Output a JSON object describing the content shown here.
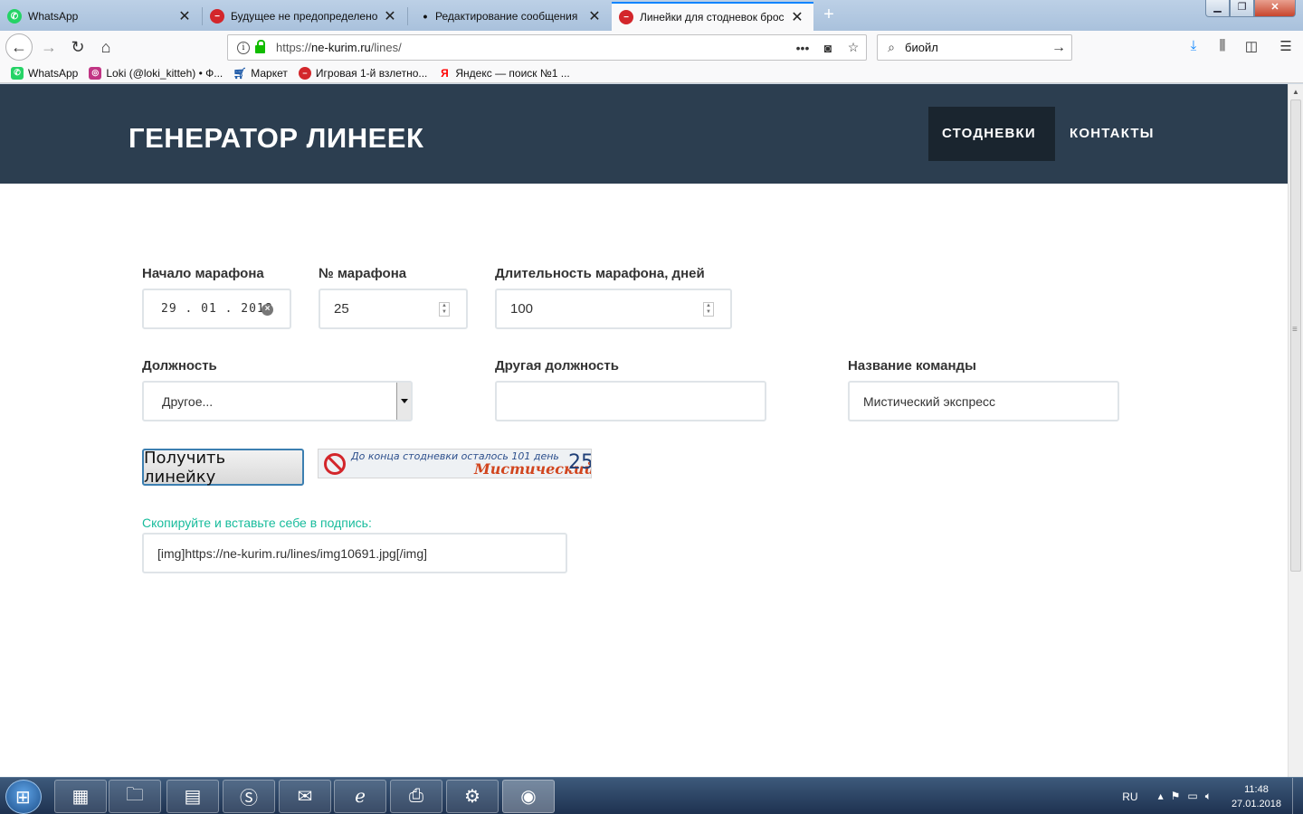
{
  "tabs": [
    {
      "title": "WhatsApp",
      "icon": "whatsapp-icon",
      "color": "#25d366"
    },
    {
      "title": "Будущее не предопределено",
      "icon": "no-entry-icon",
      "color": "#d3262b"
    },
    {
      "title": "Редактирование сообщения",
      "icon": "dot-icon",
      "color": "#333333"
    },
    {
      "title": "Линейки для стодневок брос",
      "icon": "no-entry-icon",
      "color": "#d3262b"
    }
  ],
  "nav": {
    "url_prefix": "https://",
    "url_host": "ne-kurim.ru",
    "url_path": "/lines/",
    "search_value": "биойл"
  },
  "bookmarks": [
    {
      "label": "WhatsApp",
      "icon": "whatsapp-icon",
      "color": "#25d366"
    },
    {
      "label": "Loki (@loki_kitteh) • Ф...",
      "icon": "instagram-icon",
      "color": "#c13584"
    },
    {
      "label": "Маркет",
      "icon": "cart-icon",
      "color": "#1e5aa8"
    },
    {
      "label": "Игровая 1-й взлетно...",
      "icon": "no-entry-icon",
      "color": "#d3262b"
    },
    {
      "label": "Яндекс — поиск №1 ...",
      "icon": "yandex-icon",
      "color": "#ff0000"
    }
  ],
  "site": {
    "brand": "ГЕНЕРАТОР ЛИНЕЕК",
    "menu": [
      "СТОДНЕВКИ",
      "КОНТАКТЫ"
    ]
  },
  "form": {
    "start_label": "Начало марафона",
    "start_value": "29 . 01 . 2018",
    "number_label": "№ марафона",
    "number_value": "25",
    "duration_label": "Длительность марафона, дней",
    "duration_value": "100",
    "position_label": "Должность",
    "position_value": "Другое...",
    "other_label": "Другая должность",
    "other_value": "",
    "team_label": "Название команды",
    "team_value": "Мистический экспресс",
    "submit": "Получить линейку",
    "copy_hint": "Скопируйте и вставьте себе в подпись:",
    "copy_value": "[img]https://ne-kurim.ru/lines/img10691.jpg[/img]"
  },
  "ruler": {
    "text": "До конца стодневки осталось 101 день",
    "team": "Мистический",
    "number": "25"
  },
  "taskbar": {
    "lang": "RU",
    "time": "11:48",
    "date": "27.01.2018"
  },
  "colors": {
    "header_bg": "#2c3e50",
    "menu_active_bg": "#1a252f",
    "accent_teal": "#18bc9c",
    "firefox_blue": "#0a84ff"
  }
}
